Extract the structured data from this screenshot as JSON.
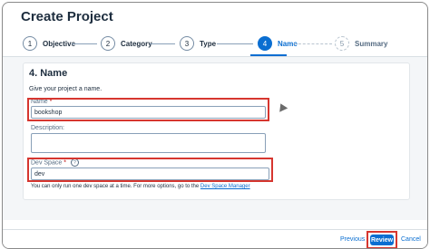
{
  "dialog": {
    "title": "Create Project"
  },
  "steps": [
    {
      "num": "1",
      "label": "Objective",
      "state": "done"
    },
    {
      "num": "2",
      "label": "Category",
      "state": "done"
    },
    {
      "num": "3",
      "label": "Type",
      "state": "done"
    },
    {
      "num": "4",
      "label": "Name",
      "state": "active"
    },
    {
      "num": "5",
      "label": "Summary",
      "state": "future"
    }
  ],
  "form": {
    "section_title": "4. Name",
    "hint": "Give your project a name.",
    "name_label": "Name",
    "required_mark": "*",
    "name_value": "bookshop",
    "description_label": "Description:",
    "description_value": "",
    "devspace_label": "Dev Space",
    "devspace_value": "dev",
    "note_text": "You can only run one dev space at a time. For more options, go to the",
    "note_link": "Dev Space Manager"
  },
  "footer": {
    "previous_label": "Previous",
    "review_label": "Review",
    "cancel_label": "Cancel"
  },
  "colors": {
    "accent": "#0a6ed1",
    "highlight": "#d6362f"
  }
}
